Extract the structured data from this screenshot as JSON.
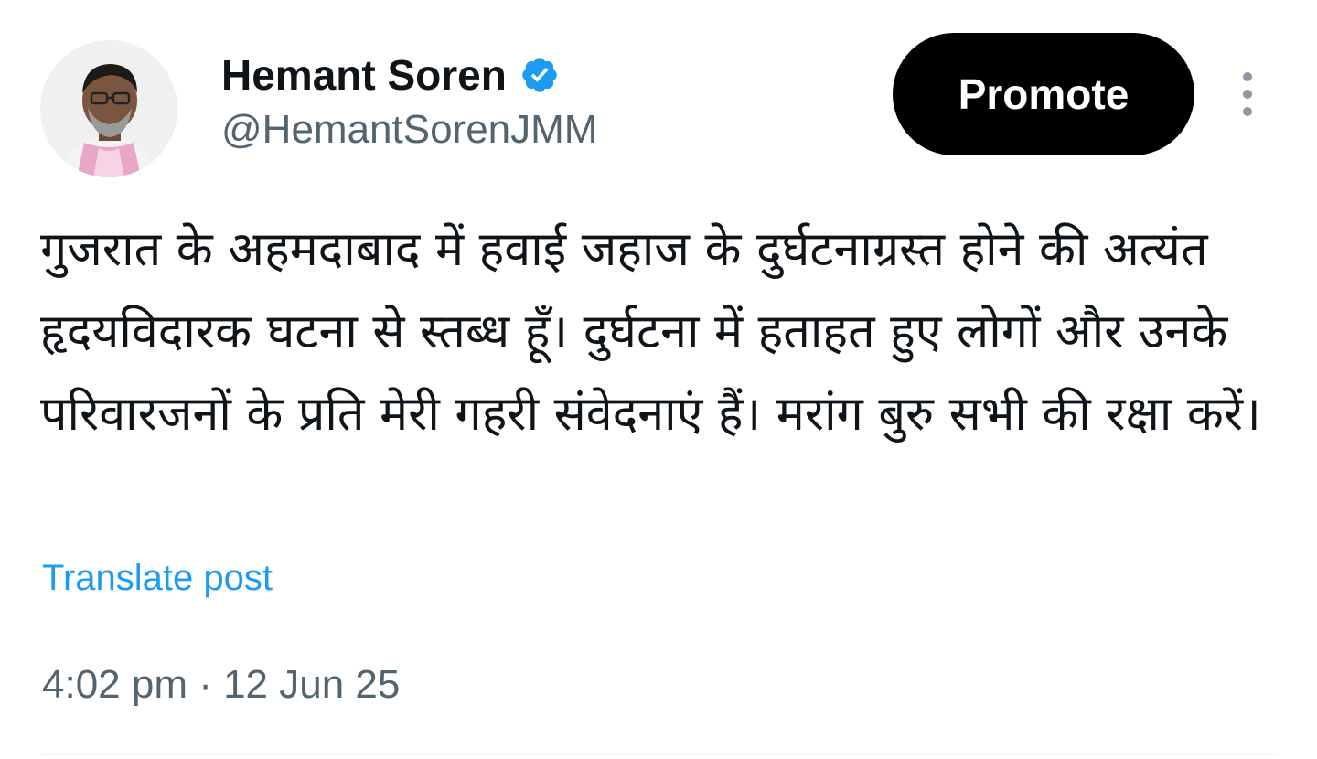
{
  "author": {
    "display_name": "Hemant Soren",
    "handle": "@HemantSorenJMM",
    "verified": true,
    "avatar_icon": "profile-photo"
  },
  "actions": {
    "promote_label": "Promote",
    "more_icon": "vertical-ellipsis-icon"
  },
  "post": {
    "text": "गुजरात के अहमदाबाद में हवाई जहाज के दुर्घटनाग्रस्त होने की अत्यंत हृदयविदारक घटना से स्तब्ध हूँ। दुर्घटना में हताहत हुए लोगों और उनके परिवारजनों के प्रति मेरी गहरी संवेदनाएं हैं। मरांग बुरु सभी की रक्षा करें।",
    "translate_label": "Translate post",
    "timestamp": "4:02 pm · 12 Jun 25"
  },
  "colors": {
    "link": "#1d9bf0",
    "verified_badge": "#1d9bf0",
    "secondary_text": "#536471",
    "button_bg": "#000000"
  }
}
